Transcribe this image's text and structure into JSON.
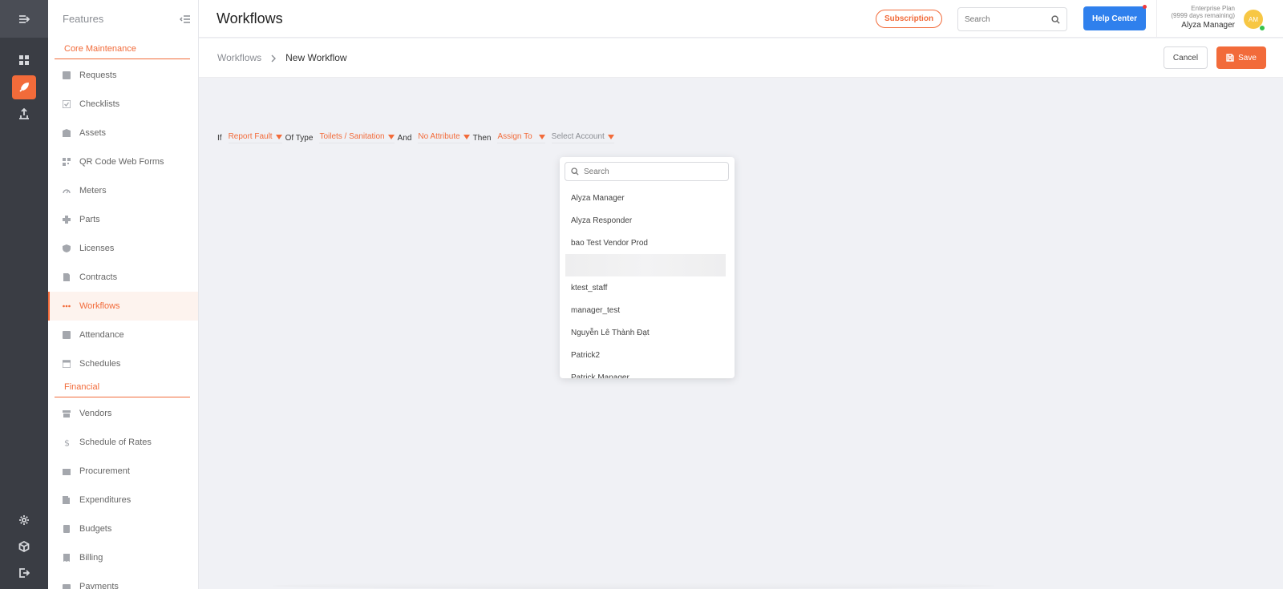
{
  "sidebar": {
    "title": "Features",
    "sections": [
      {
        "label": "Core Maintenance",
        "items": [
          {
            "label": "Requests",
            "icon": "request-icon"
          },
          {
            "label": "Checklists",
            "icon": "checklist-icon"
          },
          {
            "label": "Assets",
            "icon": "asset-icon"
          },
          {
            "label": "QR Code Web Forms",
            "icon": "qr-code-icon"
          },
          {
            "label": "Meters",
            "icon": "meter-icon"
          },
          {
            "label": "Parts",
            "icon": "parts-icon"
          },
          {
            "label": "Licenses",
            "icon": "shield-icon"
          },
          {
            "label": "Contracts",
            "icon": "contract-icon"
          },
          {
            "label": "Workflows",
            "icon": "workflow-icon",
            "active": true
          },
          {
            "label": "Attendance",
            "icon": "attendance-icon"
          },
          {
            "label": "Schedules",
            "icon": "calendar-icon"
          }
        ]
      },
      {
        "label": "Financial",
        "items": [
          {
            "label": "Vendors",
            "icon": "store-icon"
          },
          {
            "label": "Schedule of Rates",
            "icon": "dollar-icon"
          },
          {
            "label": "Procurement",
            "icon": "procurement-icon"
          },
          {
            "label": "Expenditures",
            "icon": "wallet-icon"
          },
          {
            "label": "Budgets",
            "icon": "calculator-icon"
          },
          {
            "label": "Billing",
            "icon": "billing-icon"
          },
          {
            "label": "Payments",
            "icon": "payment-icon"
          }
        ]
      }
    ]
  },
  "header": {
    "title": "Workflows",
    "subscription_label": "Subscription",
    "search_placeholder": "Search",
    "help_label": "Help Center",
    "plan_name": "Enterprise Plan",
    "plan_days": "(9999 days remaining)",
    "user_name": "Alyza Manager",
    "avatar_initials": "AM"
  },
  "breadcrumb": {
    "parent": "Workflows",
    "current": "New Workflow"
  },
  "actions": {
    "cancel_label": "Cancel",
    "save_label": "Save"
  },
  "rule": {
    "if": "If",
    "event": "Report Fault",
    "of_type": "Of Type",
    "type": "Toilets / Sanitation",
    "and": "And",
    "attribute": "No Attribute",
    "then": "Then",
    "action": "Assign To",
    "account_placeholder": "Select Account"
  },
  "account_dropdown": {
    "search_placeholder": "Search",
    "options": [
      "Alyza Manager",
      "Alyza Responder",
      "bao Test Vendor Prod",
      "",
      "ktest_staff",
      "manager_test",
      "Nguyễn Lê Thành Đạt",
      "Patrick2",
      "Patrick Manager"
    ]
  },
  "colors": {
    "accent": "#f26b3a",
    "primary_blue": "#2f80ed",
    "rail_bg": "#3a3d44"
  }
}
